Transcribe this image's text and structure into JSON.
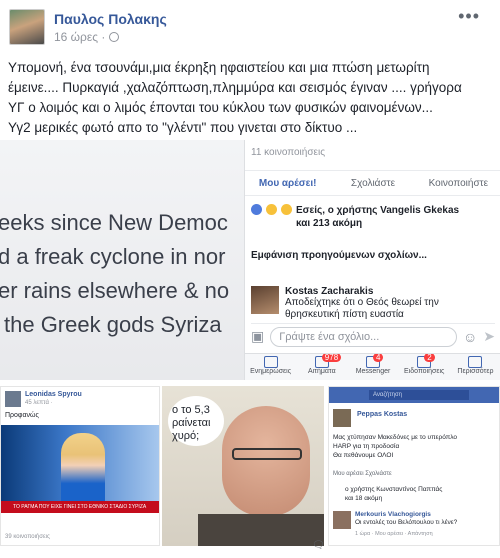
{
  "post": {
    "author": "Παυλος Πολακης",
    "time": "16 ώρες ·",
    "more_icon": "more-horizontal-icon",
    "text_lines": [
      "Υπομονή, ένα τσουνάμι,μια έκρηξη ηφαιστείου και μια πτώση μετωρίτη",
      "έμεινε.... Πυρκαγιά ,χαλαζόπτωση,πλημμύρα και σεισμός έγιναν .... γρήγορα",
      "ΥΓ ο λοιμός και ο λιμός έπονται του κύκλου των φυσικών φαινομένων...",
      "Υγ2 μερικές φωτό απο το \"γλέντι\" που γινεται στο δίκτυο ..."
    ]
  },
  "screenshot": {
    "ticker_lines": [
      "eeks since New Democ",
      "d a freak cyclone in nor",
      "er rains elsewhere & no",
      "the Greek gods Syriza"
    ],
    "shares": "11 κοινοποιήσεις",
    "actions": {
      "like": "Μου αρέσει!",
      "comment": "Σχολιάστε",
      "share": "Κοινοποιήστε"
    },
    "reactions_line1": "Εσείς, ο χρήστης Vangelis Gkekas",
    "reactions_line2": "και 213 ακόμη",
    "prev_comments": "Εμφάνιση προηγούμενων σχολίων...",
    "comment_author": "Kostas Zacharakis",
    "comment_line1": "Αποδείχτηκε ότι ο Θεός θεωρεί την",
    "comment_line2": "θρησκευτική πίστη ευαστία",
    "write_placeholder": "Γράψτε ένα σχόλιο...",
    "nav": [
      {
        "label": "Ενημερώσεις",
        "badge": ""
      },
      {
        "label": "Αιτήματα",
        "badge": "978"
      },
      {
        "label": "Messenger",
        "badge": "4"
      },
      {
        "label": "Ειδοποιήσεις",
        "badge": "2"
      },
      {
        "label": "Περισσότερ",
        "badge": ""
      }
    ]
  },
  "collage": {
    "left": {
      "author": "Leonidas Spyrou",
      "time": "45 λεπτά ·",
      "text": "Προφανώς",
      "ticker": "ΤΟ ΡΑΓΜΑ ΠΟΥ ΕΙΧΕ ΓΙΝΕΙ ΣΤΟ ΕΘΝΙΚΟ ΣΤΑΔΙΟ ΣΥΡΙΖΑ",
      "comments": "39 κοινοποιήσεις"
    },
    "middle": {
      "bubble_lines": [
        "ο το 5,3",
        "ραίνεται",
        "χυρό;"
      ]
    },
    "right": {
      "search": "Αναζήτηση",
      "author": "Peppas Kostas",
      "text_lines": [
        "Μας χτύπησαν Μακεδόνες με το υπερόπλο",
        "HARP για τη προδοσία",
        "Θα πεθάνουμε ΟΛΟΙ"
      ],
      "actions": "Μου αρέσει   Σχολιάστε",
      "reactions": [
        "ο χρήστης Κωνσταντίνος Παππάς",
        "και 18 ακόμη"
      ],
      "comment_author": "Merkouris Vlachogiorgis",
      "comment_text": "Οι εντολές του Βελόπουλου τι λένε?",
      "comment_time": "1 ώρα · Μου αρέσει · Απάντηση"
    }
  },
  "comment_icon": "speech-bubble-dots-icon"
}
